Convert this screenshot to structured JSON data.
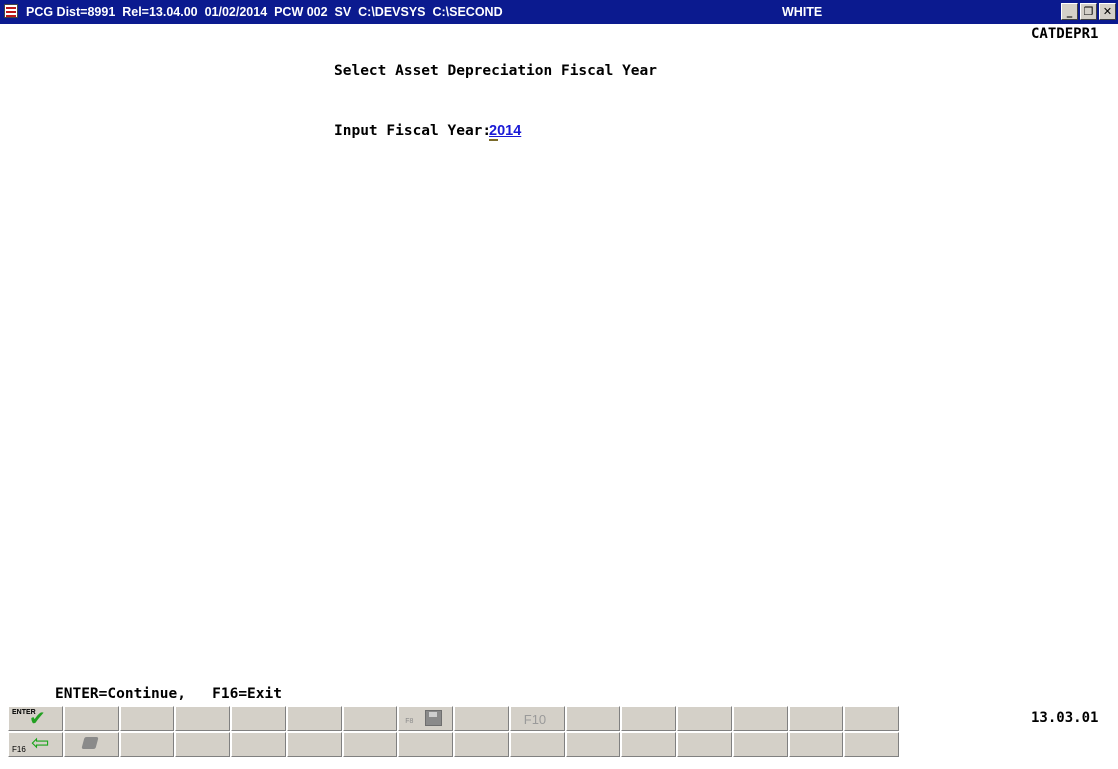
{
  "window": {
    "title": "PCG Dist=8991  Rel=13.04.00  01/02/2014  PCW 002  SV  C:\\DEVSYS  C:\\SECOND",
    "title_right": "WHITE",
    "controls": [
      "minimize",
      "restore",
      "close"
    ]
  },
  "screen": {
    "id": "CATDEPR1",
    "heading": "Select Asset Depreciation Fiscal Year",
    "prompt_label": "Input Fiscal Year:",
    "fiscal_year_value": "2014",
    "fkey_hint": "ENTER=Continue,   F16=Exit",
    "version": "13.03.01"
  },
  "function_bar": {
    "enter_label": "ENTER",
    "f16_label": "F16",
    "f8_label": "F8",
    "f10_label": "F10"
  },
  "colors": {
    "titlebar": "#0b1a8f",
    "input_text": "#1a1ad6",
    "button_face": "#d4d0c8",
    "enter_icon": "#22a022",
    "exit_icon": "#1aa51a"
  }
}
